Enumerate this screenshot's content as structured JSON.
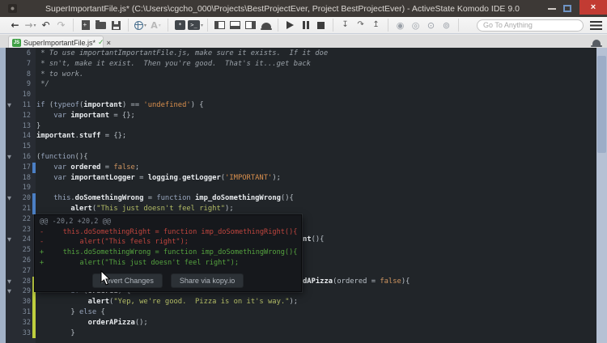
{
  "window": {
    "title": "SuperImportantFile.js* (C:\\Users\\cgcho_000\\Projects\\BestProjectEver, Project BestProjectEver) - ActiveState Komodo IDE 9.0",
    "controls": [
      "minimize",
      "maximize",
      "close"
    ]
  },
  "toolbar": {
    "groups": [
      [
        "back",
        "forward",
        "undo",
        "redo"
      ],
      [
        "new-file",
        "open-folder",
        "save"
      ],
      [
        "preview-globe",
        "font-size"
      ],
      [
        "macro",
        "console"
      ],
      [
        "pane-left",
        "pane-bottom",
        "pane-right",
        "lamp"
      ],
      [
        "run",
        "pause",
        "stop"
      ],
      [
        "step-in",
        "step-over",
        "step-out"
      ],
      [
        "record",
        "stop-record",
        "play-macro",
        "save-macro"
      ]
    ],
    "search_placeholder": "Go To Anything"
  },
  "tab": {
    "badge": "JS",
    "label": "SuperImportantFile.js*",
    "check": "✓",
    "close": "×"
  },
  "editor": {
    "first_line": 6,
    "lines": [
      {
        "n": 6,
        "tokens": [
          [
            "c",
            " * To use importantImportantFile.js, make sure it exists.  If it doe"
          ]
        ]
      },
      {
        "n": 7,
        "tokens": [
          [
            "c",
            " * sn't, make it exist.  Then you're good.  That's it...get back"
          ]
        ]
      },
      {
        "n": 8,
        "tokens": [
          [
            "c",
            " * to work."
          ]
        ]
      },
      {
        "n": 9,
        "tokens": [
          [
            "c",
            " */"
          ]
        ]
      },
      {
        "n": 10,
        "tokens": []
      },
      {
        "n": 11,
        "fold": true,
        "tokens": [
          [
            "k",
            "if"
          ],
          [
            "p",
            " ("
          ],
          [
            "k",
            "typeof"
          ],
          [
            "p",
            "("
          ],
          [
            "i",
            "important"
          ],
          [
            "p",
            ") == "
          ],
          [
            "s1",
            "'undefined'"
          ],
          [
            "p",
            ") {"
          ]
        ]
      },
      {
        "n": 12,
        "tokens": [
          [
            "p",
            "    "
          ],
          [
            "k",
            "var"
          ],
          [
            "p",
            " "
          ],
          [
            "i",
            "important"
          ],
          [
            "p",
            " = {};"
          ]
        ]
      },
      {
        "n": 13,
        "tokens": [
          [
            "p",
            "}"
          ]
        ]
      },
      {
        "n": 14,
        "tokens": [
          [
            "i",
            "important"
          ],
          [
            "p",
            "."
          ],
          [
            "i",
            "stuff"
          ],
          [
            "p",
            " = {};"
          ]
        ]
      },
      {
        "n": 15,
        "tokens": []
      },
      {
        "n": 16,
        "fold": true,
        "tokens": [
          [
            "p",
            "("
          ],
          [
            "k",
            "function"
          ],
          [
            "p",
            "(){"
          ]
        ]
      },
      {
        "n": 17,
        "mark": "blue",
        "tokens": [
          [
            "p",
            "    "
          ],
          [
            "k",
            "var"
          ],
          [
            "p",
            " "
          ],
          [
            "i",
            "ordered"
          ],
          [
            "p",
            " = "
          ],
          [
            "b",
            "false"
          ],
          [
            "p",
            ";"
          ]
        ]
      },
      {
        "n": 18,
        "tokens": [
          [
            "p",
            "    "
          ],
          [
            "k",
            "var"
          ],
          [
            "p",
            " "
          ],
          [
            "i",
            "importantLogger"
          ],
          [
            "p",
            " = "
          ],
          [
            "i",
            "logging"
          ],
          [
            "p",
            "."
          ],
          [
            "i",
            "getLogger"
          ],
          [
            "p",
            "("
          ],
          [
            "s1",
            "'IMPORTANT'"
          ],
          [
            "p",
            ");"
          ]
        ]
      },
      {
        "n": 19,
        "tokens": []
      },
      {
        "n": 20,
        "fold": true,
        "mark": "blue",
        "tokens": [
          [
            "p",
            "    "
          ],
          [
            "k",
            "this"
          ],
          [
            "p",
            "."
          ],
          [
            "i",
            "doSomethingWrong"
          ],
          [
            "p",
            " = "
          ],
          [
            "k",
            "function"
          ],
          [
            "p",
            " "
          ],
          [
            "i",
            "imp_doSomethingWrong"
          ],
          [
            "p",
            "(){"
          ]
        ]
      },
      {
        "n": 21,
        "mark": "blue",
        "tokens": [
          [
            "p",
            "        "
          ],
          [
            "i",
            "alert"
          ],
          [
            "p",
            "("
          ],
          [
            "s2",
            "\"This just doesn't feel right\""
          ],
          [
            "p",
            ");"
          ]
        ]
      },
      {
        "n": 22
      },
      {
        "n": 23
      },
      {
        "n": 24,
        "fold": true,
        "tail": [
          [
            "i",
            "nt"
          ],
          [
            "p",
            "(){"
          ]
        ]
      },
      {
        "n": 25
      },
      {
        "n": 26
      },
      {
        "n": 27
      },
      {
        "n": 28,
        "fold": true,
        "mark": "yellow",
        "tail": [
          [
            "i",
            "dAPizza"
          ],
          [
            "p",
            "(ordered = "
          ],
          [
            "b",
            "false"
          ],
          [
            "p",
            "){"
          ]
        ]
      },
      {
        "n": 29,
        "fold": true,
        "mark": "yellow",
        "tokens": [
          [
            "p",
            "        "
          ],
          [
            "k",
            "if"
          ],
          [
            "p",
            " ("
          ],
          [
            "i",
            "ordered"
          ],
          [
            "p",
            ") {"
          ]
        ]
      },
      {
        "n": 30,
        "mark": "yellow",
        "tokens": [
          [
            "p",
            "            "
          ],
          [
            "i",
            "alert"
          ],
          [
            "p",
            "("
          ],
          [
            "s2",
            "\"Yep, we're good.  Pizza is on it's way.\""
          ],
          [
            "p",
            ");"
          ]
        ]
      },
      {
        "n": 31,
        "mark": "yellow",
        "tokens": [
          [
            "p",
            "        } "
          ],
          [
            "k",
            "else"
          ],
          [
            "p",
            " {"
          ]
        ]
      },
      {
        "n": 32,
        "mark": "yellow",
        "tokens": [
          [
            "p",
            "            "
          ],
          [
            "i",
            "orderAPizza"
          ],
          [
            "p",
            "();"
          ]
        ]
      },
      {
        "n": 33,
        "mark": "yellow",
        "tokens": [
          [
            "p",
            "        }"
          ]
        ]
      }
    ]
  },
  "diff_popup": {
    "header": "@@ -20,2 +20,2 @@",
    "lines": [
      {
        "sign": "-",
        "text": "    this.doSomethingRight = function imp_doSomethingRight(){"
      },
      {
        "sign": "-",
        "text": "        alert(\"This feels right\");"
      },
      {
        "sign": "+",
        "text": "    this.doSomethingWrong = function imp_doSomethingWrong(){"
      },
      {
        "sign": "+",
        "text": "        alert(\"This just doesn't feel right\");"
      }
    ],
    "buttons": [
      {
        "label": "Revert Changes",
        "name": "revert-changes-button"
      },
      {
        "label": "Share via kopy.io",
        "name": "share-kopy-button"
      }
    ]
  }
}
